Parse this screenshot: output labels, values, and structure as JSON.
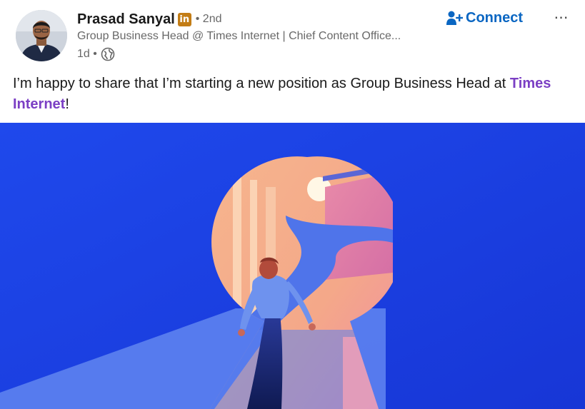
{
  "author": {
    "name": "Prasad Sanyal",
    "badge": "in",
    "degree": "• 2nd",
    "headline": "Group Business Head @ Times Internet | Chief Content Office...",
    "time": "1d •",
    "visibility_icon": "globe-icon",
    "avatar_icon": "profile-photo"
  },
  "actions": {
    "connect_label": "Connect",
    "connect_icon": "add-person-icon",
    "more_label": "⋯",
    "more_icon": "more-options-icon"
  },
  "post": {
    "text_before": "I’m happy to share that I’m starting a new position as Group Business Head at ",
    "mention": "Times Internet",
    "text_after": "!"
  },
  "colors": {
    "accent": "#0a66c2",
    "mention": "#7b3fc4",
    "badge": "#c37d16",
    "image_background": "#1c3fe0"
  }
}
